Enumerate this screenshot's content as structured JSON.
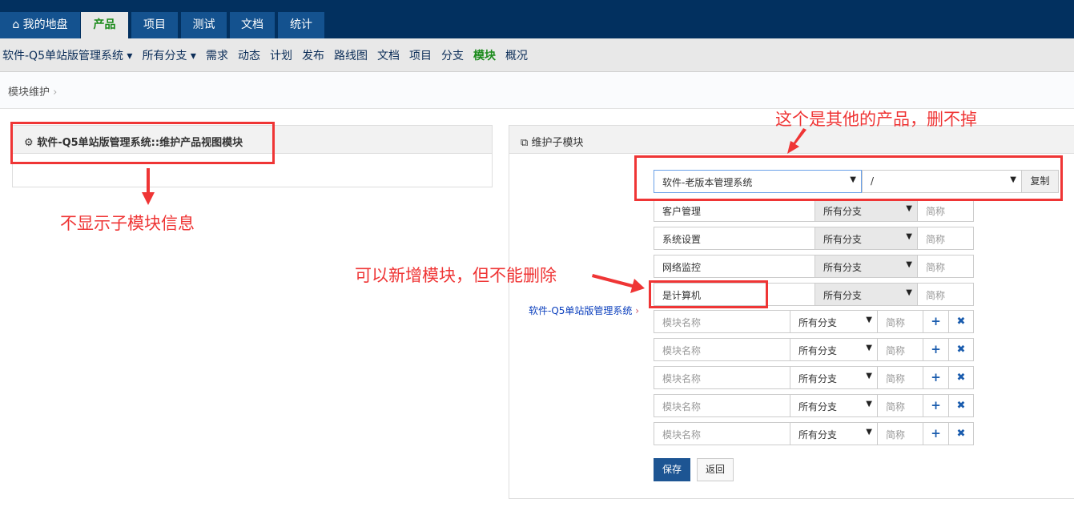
{
  "topnav": {
    "tabs": [
      {
        "label": "我的地盘",
        "icon": "home-icon"
      },
      {
        "label": "产品"
      },
      {
        "label": "项目"
      },
      {
        "label": "测试"
      },
      {
        "label": "文档"
      },
      {
        "label": "统计"
      }
    ]
  },
  "subnav": {
    "product": "软件-Q5单站版管理系统",
    "branch": "所有分支",
    "items": [
      "需求",
      "动态",
      "计划",
      "发布",
      "路线图",
      "文档",
      "项目",
      "分支",
      "模块",
      "概况"
    ]
  },
  "breadcrumb": "模块维护",
  "left_panel": {
    "title": "软件-Q5单站版管理系统::维护产品视图模块"
  },
  "right_panel": {
    "title": "维护子模块",
    "root_link": "软件-Q5单站版管理系统",
    "copy": {
      "product": "软件-老版本管理系统",
      "path": "/",
      "button": "复制"
    },
    "existing": [
      {
        "name": "客户管理",
        "branch": "所有分支",
        "short_placeholder": "简称"
      },
      {
        "name": "系统设置",
        "branch": "所有分支",
        "short_placeholder": "简称"
      },
      {
        "name": "网络监控",
        "branch": "所有分支",
        "short_placeholder": "简称"
      },
      {
        "name": "是计算机",
        "branch": "所有分支",
        "short_placeholder": "简称"
      }
    ],
    "new_rows": [
      {
        "placeholder": "模块名称",
        "branch": "所有分支",
        "short_placeholder": "简称"
      },
      {
        "placeholder": "模块名称",
        "branch": "所有分支",
        "short_placeholder": "简称"
      },
      {
        "placeholder": "模块名称",
        "branch": "所有分支",
        "short_placeholder": "简称"
      },
      {
        "placeholder": "模块名称",
        "branch": "所有分支",
        "short_placeholder": "简称"
      },
      {
        "placeholder": "模块名称",
        "branch": "所有分支",
        "short_placeholder": "简称"
      }
    ],
    "save": "保存",
    "back": "返回"
  },
  "annotations": {
    "left": "不显示子模块信息",
    "middle": "可以新增模块，但不能删除",
    "top": "这个是其他的产品，删不掉"
  }
}
